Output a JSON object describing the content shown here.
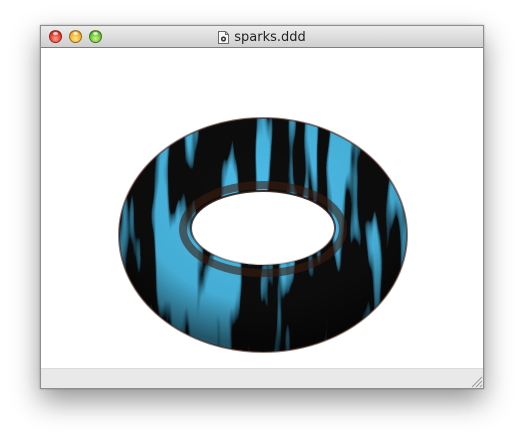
{
  "window": {
    "title": "sparks.ddd",
    "controls": {
      "close": "close-button",
      "minimize": "minimize-button",
      "zoom": "zoom-button"
    },
    "document_icon": "document-icon"
  },
  "viewport": {
    "object": "torus",
    "texture": "blue-sparks",
    "colors": {
      "base": "#0a0d10",
      "glow": "#1fa3e6",
      "background": "#ffffff"
    }
  },
  "statusbar": {
    "resize_grip": "resize-grip-icon"
  }
}
